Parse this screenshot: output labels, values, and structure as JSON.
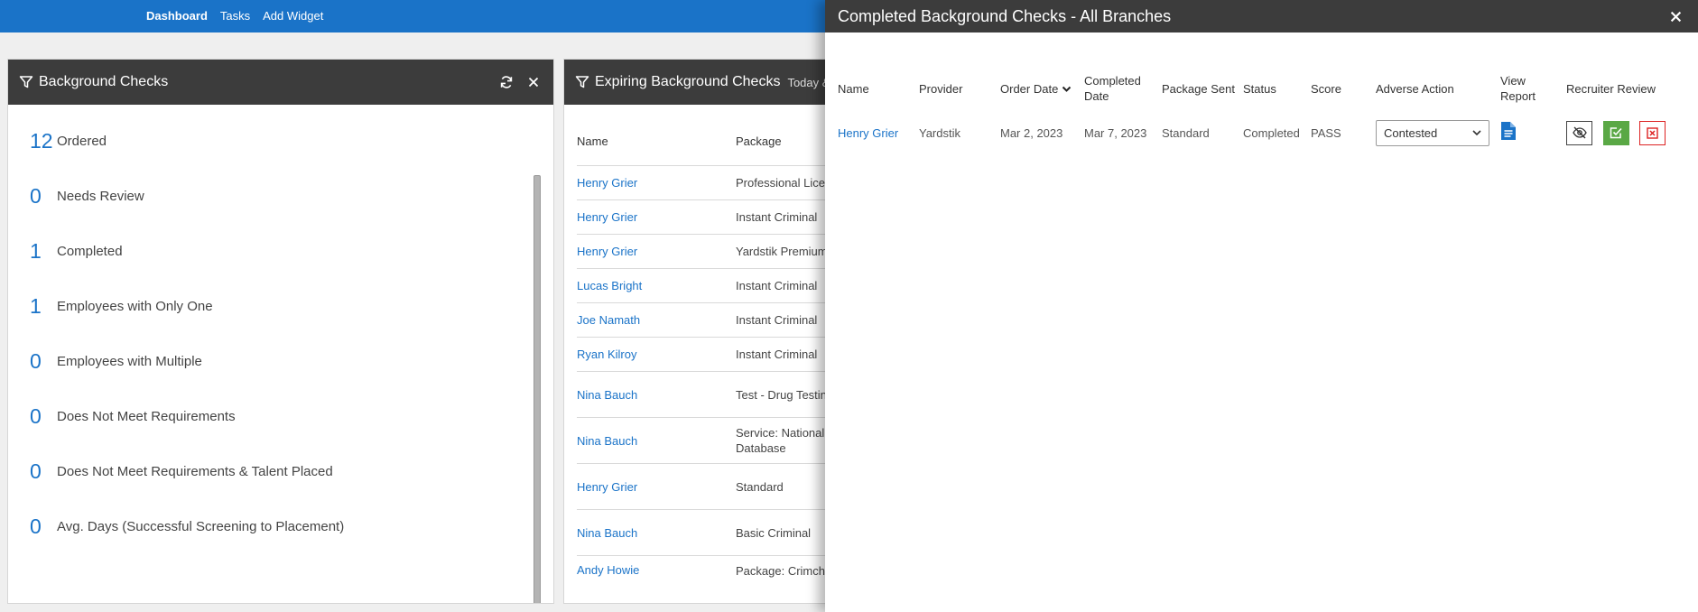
{
  "nav": {
    "items": [
      "Dashboard",
      "Tasks",
      "Add Widget"
    ]
  },
  "bg_widget": {
    "title": "Background Checks",
    "stats": [
      {
        "num": "12",
        "label": "Ordered"
      },
      {
        "num": "0",
        "label": "Needs Review"
      },
      {
        "num": "1",
        "label": "Completed"
      },
      {
        "num": "1",
        "label": "Employees with Only One"
      },
      {
        "num": "0",
        "label": "Employees with Multiple"
      },
      {
        "num": "0",
        "label": "Does Not Meet Requirements"
      },
      {
        "num": "0",
        "label": "Does Not Meet Requirements & Talent Placed"
      },
      {
        "num": "0",
        "label": "Avg. Days (Successful Screening to Placement)"
      }
    ]
  },
  "exp_widget": {
    "title": "Expiring Background Checks",
    "subtitle": "Today &",
    "columns": {
      "name": "Name",
      "package": "Package"
    },
    "rows": [
      {
        "name": "Henry Grier",
        "package": "Professional Licen"
      },
      {
        "name": "Henry Grier",
        "package": "Instant Criminal"
      },
      {
        "name": "Henry Grier",
        "package": "Yardstik Premium"
      },
      {
        "name": "Lucas Bright",
        "package": "Instant Criminal"
      },
      {
        "name": "Joe Namath",
        "package": "Instant Criminal"
      },
      {
        "name": "Ryan Kilroy",
        "package": "Instant Criminal"
      },
      {
        "name": "Nina Bauch",
        "package": "Test - Drug Testin"
      },
      {
        "name": "Nina Bauch",
        "package": "Service: National\nDatabase"
      },
      {
        "name": "Henry Grier",
        "package": "Standard"
      },
      {
        "name": "Nina Bauch",
        "package": "Basic Criminal"
      },
      {
        "name": "Andy Howie",
        "package": "Package: Crimch"
      }
    ]
  },
  "panel": {
    "title": "Completed Background Checks - All Branches",
    "headers": {
      "name": "Name",
      "provider": "Provider",
      "order_date": "Order Date",
      "completed_date": "Completed\nDate",
      "package_sent": "Package Sent",
      "status": "Status",
      "score": "Score",
      "adverse": "Adverse Action",
      "view_report": "View\nReport",
      "recruiter_review": "Recruiter Review"
    },
    "row": {
      "name": "Henry Grier",
      "provider": "Yardstik",
      "order_date": "Mar 2, 2023",
      "completed_date": "Mar 7, 2023",
      "package_sent": "Standard",
      "status": "Completed",
      "score": "PASS",
      "adverse_action": "Contested"
    }
  },
  "colors": {
    "topbar": "#1a73c8",
    "header": "#3c3c3c",
    "link": "#1a73c8",
    "approve": "#5aa845",
    "reject": "#dd2222"
  }
}
